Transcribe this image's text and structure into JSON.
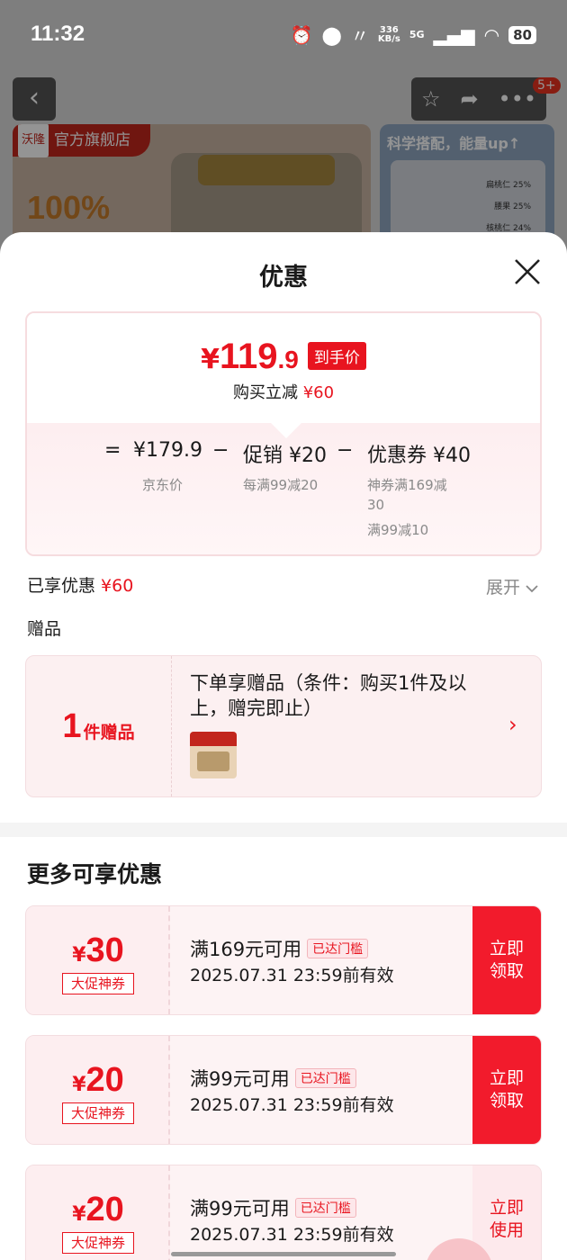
{
  "status_bar": {
    "time": "11:32",
    "net_speed_value": "336",
    "net_speed_unit": "KB/s",
    "network": "5G",
    "battery": "80"
  },
  "background_page": {
    "badge": "5+",
    "store_logo": "沃隆",
    "store_tag": "官方旗舰店",
    "banner_text": "100%",
    "banner2_title": "科学搭配，能量up↑",
    "banner2_rows": [
      "扁桃仁 25%",
      "腰果 25%",
      "核桃仁 24%"
    ]
  },
  "sheet": {
    "title": "优惠",
    "price": {
      "yen": "¥",
      "integer": "119",
      "decimal": ".9",
      "tag": "到手价",
      "reduce_label": "购买立减",
      "reduce_value": "¥60"
    },
    "calc": {
      "equals": "=",
      "minus": "−",
      "jd_price": "¥179.9",
      "jd_label": "京东价",
      "promo": "促销 ¥20",
      "promo_sub": "每满99减20",
      "coupon": "优惠券 ¥40",
      "coupon_sub1": "神券满169减",
      "coupon_sub2": "30",
      "coupon_sub3": "满99减10"
    },
    "enjoyed_label": "已享优惠",
    "enjoyed_value": "¥60",
    "expand_label": "展开",
    "gift_section_label": "赠品",
    "gift": {
      "count": "1",
      "unit": "件赠品",
      "text": "下单享赠品（条件：购买1件及以上，赠完即止）"
    },
    "more_title": "更多可享优惠",
    "coupons": [
      {
        "yen": "¥",
        "amount": "30",
        "tag": "大促神券",
        "condition": "满169元可用",
        "badge": "已达门槛",
        "date": "2025.07.31 23:59前有效",
        "btn": "立即领取"
      },
      {
        "yen": "¥",
        "amount": "20",
        "tag": "大促神券",
        "condition": "满99元可用",
        "badge": "已达门槛",
        "date": "2025.07.31 23:59前有效",
        "btn": "立即领取"
      },
      {
        "yen": "¥",
        "amount": "20",
        "tag": "大促神券",
        "condition": "满99元可用",
        "badge": "已达门槛",
        "date": "2025.07.31 23:59前有效",
        "btn": "立即使用"
      }
    ]
  },
  "colors": {
    "accent": "#e8141f",
    "claim": "#f21b2c"
  }
}
